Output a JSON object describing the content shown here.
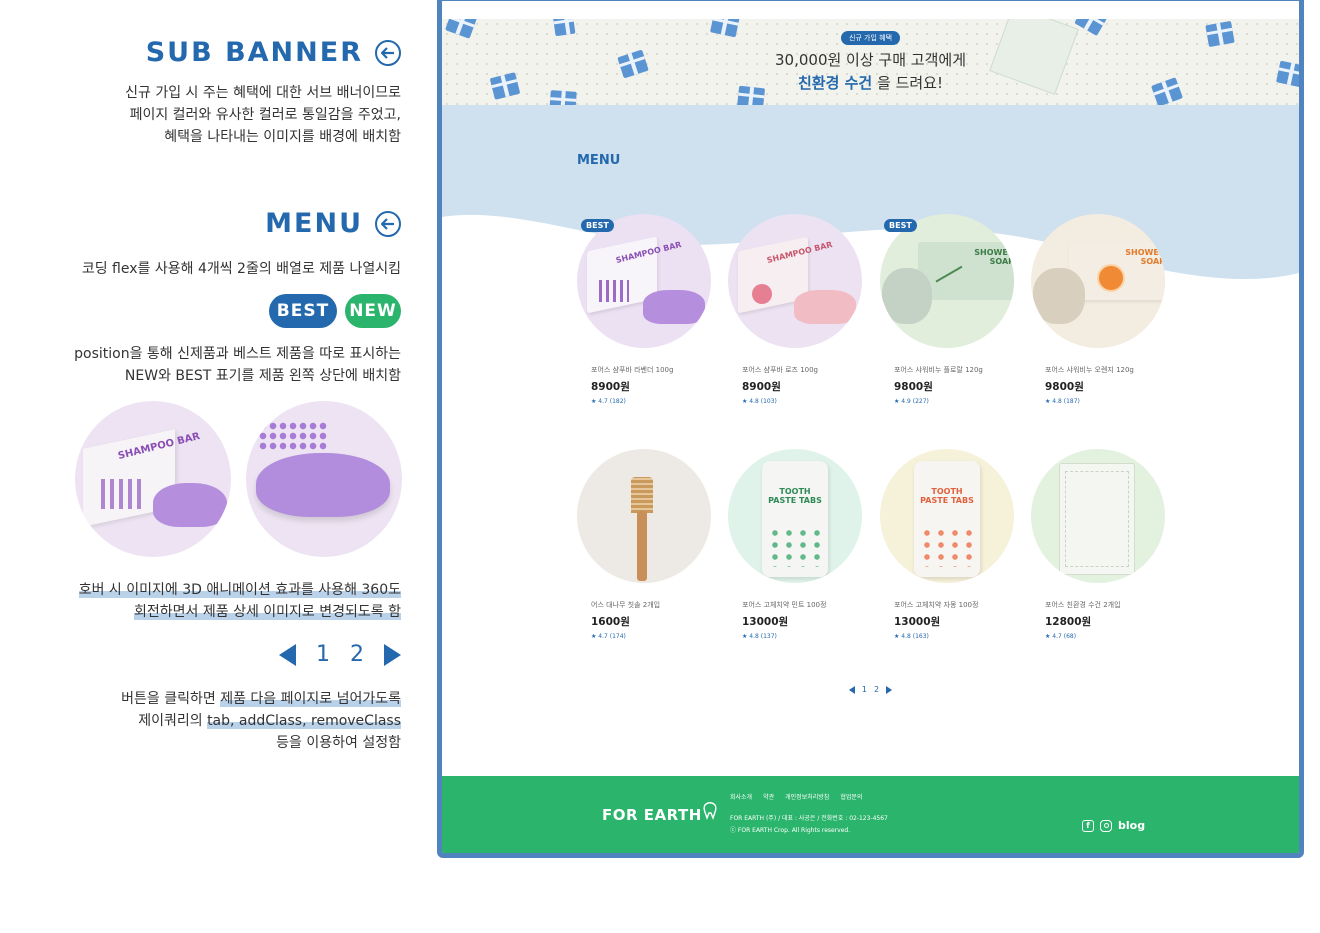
{
  "left": {
    "sub_banner": {
      "title": "SUB BANNER",
      "lines": [
        "신규 가입 시 주는 혜택에 대한 서브 배너이므로",
        "페이지 컬러와 유사한 컬러로 통일감을 주었고,",
        "혜택을 나타내는 이미지를 배경에 배치함"
      ]
    },
    "menu": {
      "title": "MENU",
      "line1": "코딩 flex를 사용해 4개씩 2줄의 배열로 제품 나열시킴",
      "badge_best": "BEST",
      "badge_new": "NEW",
      "lines2": [
        "position을 통해 신제품과 베스트 제품을 따로 표시하는",
        "NEW와 BEST 표기를 제품 왼쪽 상단에 배치함"
      ],
      "demo_label_front": "SHAMPOO BAR",
      "hover_lines": [
        "호버 시 이미지에 3D 애니메이션 효과를 사용해 360도",
        "회전하면서 제품 상세 이미지로 변경되도록 함"
      ],
      "pager_1": "1",
      "pager_2": "2",
      "click_line1_a": "버튼을 클릭하면 ",
      "click_line1_b": "제품 다음 페이지로 넘어가도록",
      "click_line2_a": "제이쿼리의 ",
      "click_line2_b": "tab, addClass, removeClass",
      "click_line3": "등을 이용하여 설정함"
    }
  },
  "page": {
    "banner": {
      "tag": "신규 가입 혜택",
      "line1": "30,000원 이상 구매 고객에게",
      "highlight": "친환경 수건",
      "line2_rest": " 을 드려요!"
    },
    "menu_title": "MENU",
    "products": [
      {
        "name": "포어스 샴푸바 라벤더 100g",
        "price": "8900원",
        "rating": "★ 4.7 (182)",
        "best": "BEST",
        "label": "SHAMPOO BAR"
      },
      {
        "name": "포어스 샴푸바 로즈 100g",
        "price": "8900원",
        "rating": "★ 4.8 (103)",
        "best": "",
        "label": "SHAMPOO BAR"
      },
      {
        "name": "포어스 샤워비누 플로랄 120g",
        "price": "9800원",
        "rating": "★ 4.9 (227)",
        "best": "BEST",
        "label": "SHOWER SOAP"
      },
      {
        "name": "포어스 샤워비누 오렌지 120g",
        "price": "9800원",
        "rating": "★ 4.8 (187)",
        "best": "",
        "label": "SHOWER SOAP"
      },
      {
        "name": "어스 대나무 칫솔 2개입",
        "price": "1600원",
        "rating": "★ 4.7 (174)",
        "best": "",
        "label": ""
      },
      {
        "name": "포어스 고체치약 민트 100정",
        "price": "13000원",
        "rating": "★ 4.8 (137)",
        "best": "",
        "label": "TOOTH PASTE TABS"
      },
      {
        "name": "포어스 고체치약 자몽 100정",
        "price": "13000원",
        "rating": "★ 4.8 (163)",
        "best": "",
        "label": "TOOTH PASTE TABS"
      },
      {
        "name": "포어스 친환경 수건 2개입",
        "price": "12800원",
        "rating": "★ 4.7 (68)",
        "best": "",
        "label": ""
      }
    ],
    "pager": {
      "p1": "1",
      "p2": "2"
    },
    "footer": {
      "logo": "FOR EARTH",
      "links": [
        "회사소개",
        "약관",
        "개인정보처리방침",
        "협업문의"
      ],
      "info1": "FOR EARTH (주) / 대표 : 사공은 / 전화번호 : 02-123-4567",
      "info2": "ⓒ FOR EARTH Crop. All Rights reserved.",
      "blog": "blog"
    }
  },
  "colors": {
    "brand_blue": "#2468ad",
    "brand_green": "#2bb46b",
    "menu_bg": "#cfe0ef"
  }
}
